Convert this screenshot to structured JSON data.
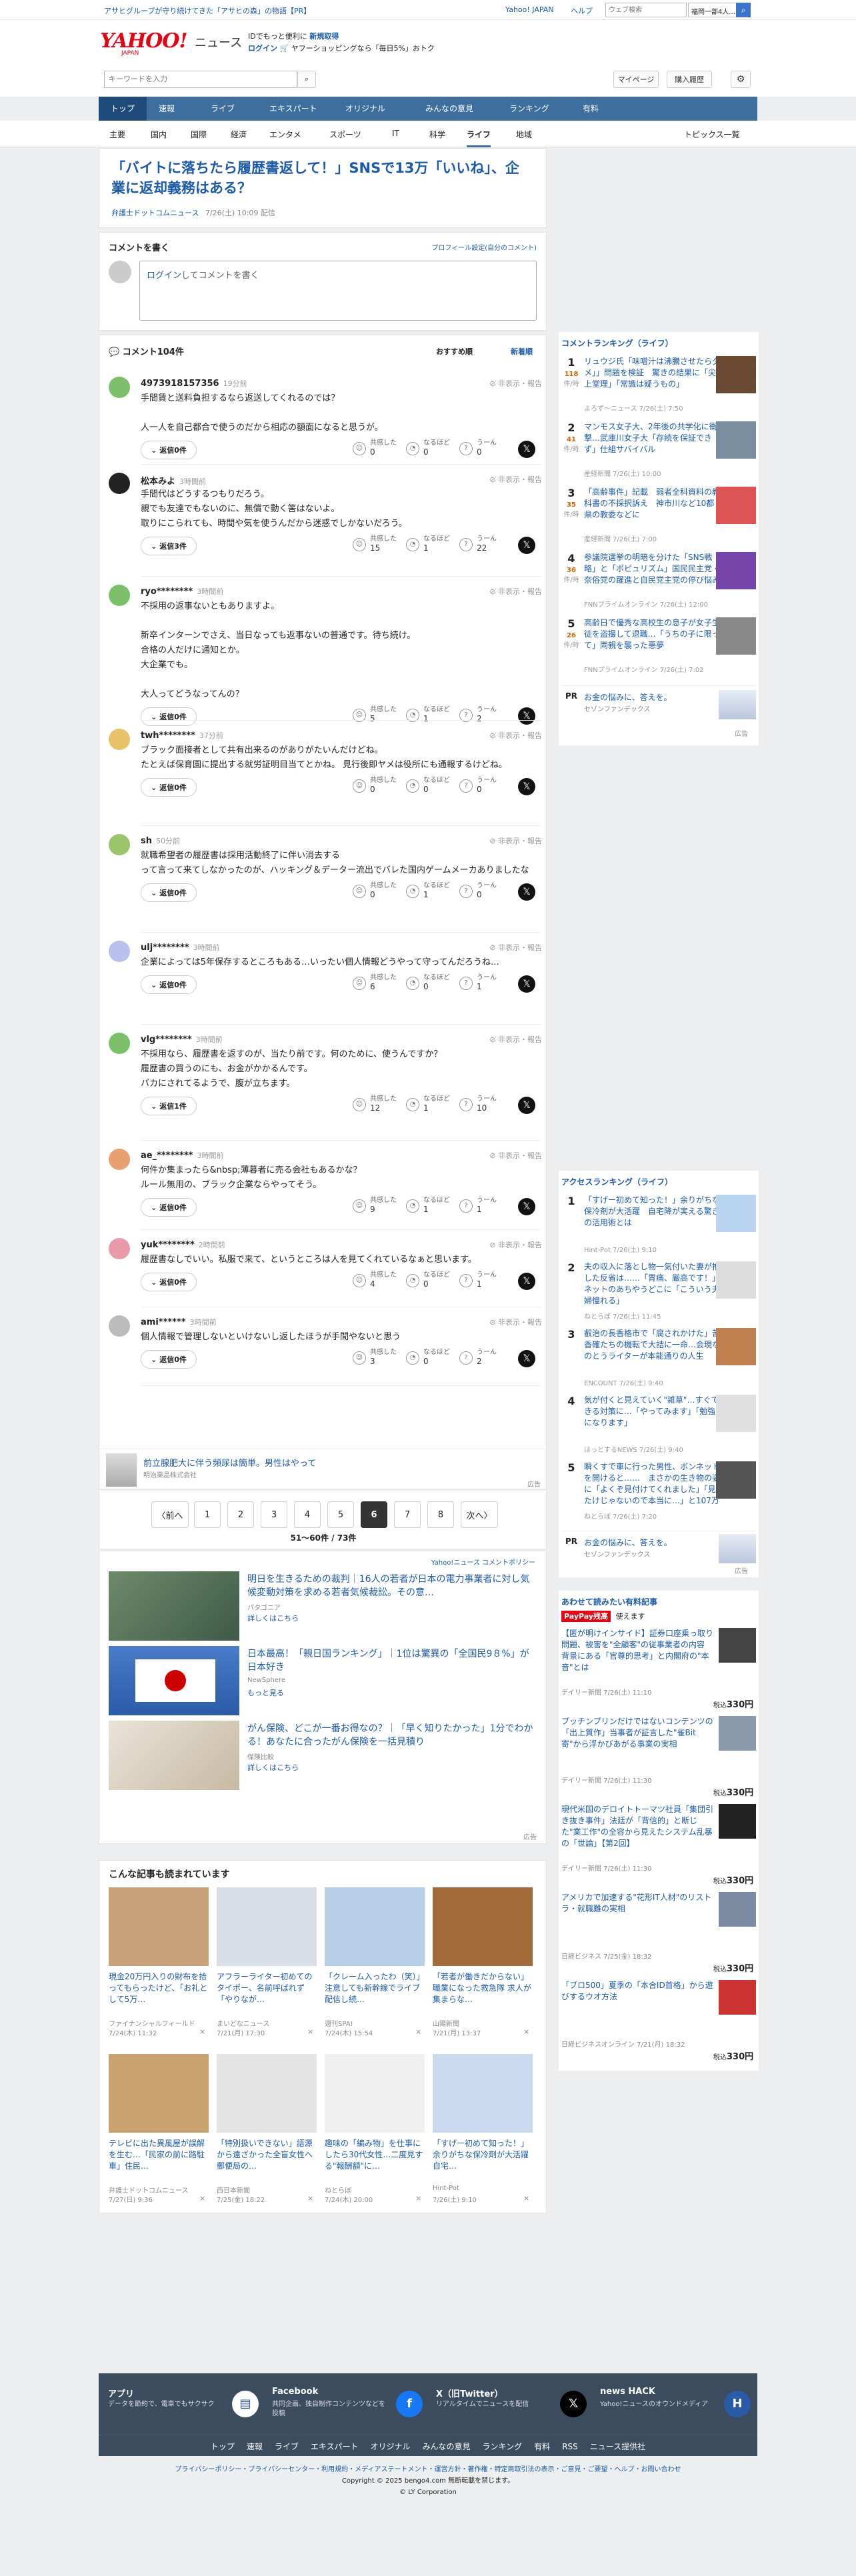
{
  "topbar": {
    "left_text": "アサヒグループが守り続けてきた「アサヒの森」の物語【PR】",
    "links": [
      "Yahoo! JAPAN",
      "ヘルプ"
    ],
    "search_placeholder": "ウェブ検索",
    "weather": "福岡一部4人..."
  },
  "header": {
    "logo": "YAHOO!",
    "logo_sub": "JAPAN",
    "brand": "ニュース",
    "promo1": "IDでもっと便利に",
    "promo1_link": "新規取得",
    "promo2_link": "ログイン",
    "promo2": "ヤフーショッピングなら「毎日5%」おトク",
    "search_placeholder": "キーワードを入力",
    "mypage": "マイページ",
    "purchase": "購入履歴"
  },
  "nav": {
    "items": [
      "トップ",
      "速報",
      "ライブ",
      "エキスパート",
      "オリジナル",
      "みんなの意見",
      "ランキング",
      "有料"
    ],
    "active": 0
  },
  "subnav": {
    "items": [
      "主要",
      "国内",
      "国際",
      "経済",
      "エンタメ",
      "スポーツ",
      "IT",
      "科学",
      "ライフ",
      "地域"
    ],
    "active": 8,
    "right": "トピックス一覧"
  },
  "article": {
    "title": "「バイトに落ちたら履歴書返して！」SNSで13万「いいね」、企業に返却義務はある？",
    "source": "弁護士ドットコムニュース",
    "date": "7/26(土) 10:09 配信"
  },
  "comment_box": {
    "heading": "コメントを書く",
    "profile_link": "プロフィール設定(自分のコメント)",
    "login_link": "ログイン",
    "placeholder_rest": "してコメントを書く"
  },
  "comments_header": {
    "title": "コメント104件",
    "sort_recommended": "おすすめ順",
    "sort_new": "新着順"
  },
  "reaction_labels": {
    "agree": "共感した",
    "understand": "なるほど",
    "hmm": "うーん"
  },
  "action_text": "非表示・報告",
  "comments": [
    {
      "name": "4973918157356",
      "time": "19分前",
      "text": "手間賃と送料負担するなら返送してくれるのでは？\n\n人一人を自己都合で使うのだから相応の額面になると思うが。",
      "reply": "返信0件",
      "agree": "0",
      "understand": "0",
      "hmm": "0",
      "color": "#7cbf6a"
    },
    {
      "name": "松本みよ",
      "time": "3時間前",
      "text": "手間代はどうするつもりだろう。\n親でも友達でもないのに、無償で動く筈はないよ。\n取りにこられても、時間や気を使うんだから迷惑でしかないだろう。",
      "reply": "返信3件",
      "agree": "15",
      "understand": "1",
      "hmm": "22",
      "color": "#222"
    },
    {
      "name": "ryo********",
      "time": "3時間前",
      "text": "不採用の返事ないともありますよ。\n\n新卒インターンでさえ、当日なっても返事ないの普通です。待ち続け。\n合格の人だけに通知とか。\n大企業でも。\n\n大人ってどうなってんの？",
      "reply": "返信0件",
      "agree": "5",
      "understand": "1",
      "hmm": "2",
      "color": "#7cbf6a"
    },
    {
      "name": "twh********",
      "time": "37分前",
      "text": "ブラック面接者として共有出来るのがありがたいんだけどね。\nたとえば保育園に提出する就労証明目当てとかね。 見行後即ヤメは役所にも通報するけどね。",
      "reply": "返信0件",
      "agree": "0",
      "understand": "0",
      "hmm": "0",
      "color": "#e8c26a"
    },
    {
      "name": "sh",
      "time": "50分前",
      "text": "就職希望者の履歴書は採用活動終了に伴い消去する\nって言って来てしなかったのが、ハッキング＆データー流出でバレた国内ゲームメーカありましたな",
      "reply": "返信0件",
      "agree": "0",
      "understand": "1",
      "hmm": "0",
      "color": "#9ac46a"
    },
    {
      "name": "ulj********",
      "time": "3時間前",
      "text": "企業によっては5年保存するところもある…いったい個人情報どうやって守ってんだろうね…",
      "reply": "返信0件",
      "agree": "6",
      "understand": "0",
      "hmm": "1",
      "color": "#b8c0ee"
    },
    {
      "name": "vlg********",
      "time": "3時間前",
      "text": "不採用なら、履歴書を返すのが、当たり前です。何のために、使うんですか？\n履歴書の買うのにも、お金がかかるんです。\nバカにされてるようで、腹が立ちます。",
      "reply": "返信1件",
      "agree": "12",
      "understand": "1",
      "hmm": "10",
      "color": "#7cbf6a"
    },
    {
      "name": "ae_********",
      "time": "3時間前",
      "text": "何件か集まったら&nbsp;薄暮者に売る会社もあるかな？\nルール無用の、ブラック企業ならやってそう。",
      "reply": "返信0件",
      "agree": "9",
      "understand": "1",
      "hmm": "1",
      "color": "#e8a070"
    },
    {
      "name": "yuk********",
      "time": "2時間前",
      "text": "履歴書なしでいい。私服で来て、というところは人を見てくれているなぁと思います。",
      "reply": "返信0件",
      "agree": "4",
      "understand": "0",
      "hmm": "1",
      "color": "#e89aaa"
    },
    {
      "name": "ami******",
      "time": "3時間前",
      "text": "個人情報で管理しないといけないし返したほうが手間やないと思う",
      "reply": "返信0件",
      "agree": "3",
      "understand": "0",
      "hmm": "2",
      "color": "#bbb"
    }
  ],
  "ad_inline": {
    "text": "前立腺肥大に伴う頻尿は簡単。男性はやって",
    "sub": "明治薬品株式会社",
    "label": "広告"
  },
  "pagination": {
    "prev": "〈前へ",
    "pages": [
      "1",
      "2",
      "3",
      "4",
      "5",
      "6",
      "7",
      "8"
    ],
    "active": "6",
    "next": "次へ〉",
    "summary": "51〜60件 / 73件"
  },
  "policy_link": "Yahoo!ニュース コメントポリシー",
  "ads": [
    {
      "title": "明日を生きるための裁判｜16人の若者が日本の電力事業者に対し気候変動対策を求める若者気候裁訟。その意…",
      "source": "パタゴニア",
      "cta": "詳しくはこちら"
    },
    {
      "title": "日本最高！「親日国ランキング」｜1位は驚異の「全国民9８%」が日本好き",
      "source": "NewSphere",
      "cta": "もっと見る"
    },
    {
      "title": "がん保険、どこが一番お得なの？｜「早く知りたかった」1分でわかる！あなたに合ったがん保険を一括見積り",
      "source": "保険比較",
      "cta": "詳しくはこちら"
    }
  ],
  "ad_label": "広告",
  "also_read": {
    "heading": "こんな記事も読まれています",
    "items": [
      {
        "title": "現金20万円入りの財布を拾ってもらったけど、「お礼として5万…",
        "source": "ファイナンシャルフィールド",
        "date": "7/24(木) 11:32"
      },
      {
        "title": "アフラーライター初めてのタイポー、名前呼ばれず「やりなが…",
        "source": "まいどなニュース",
        "date": "7/21(月) 17:30"
      },
      {
        "title": "「クレーム入ったわ（笑）」注意しても新幹線でライブ配信し続…",
        "source": "週刊SPA!",
        "date": "7/24(木) 15:54"
      },
      {
        "title": "「若者が働きだからない」職業になった救急隊 求人が集まらな…",
        "source": "山陽新聞",
        "date": "7/21(月) 13:37"
      },
      {
        "title": "テレビに出た異風屋が誤解を生む…「民家の前に路駐車」住民…",
        "source": "弁護士ドットコムニュース",
        "date": "7/27(日) 9:36"
      },
      {
        "title": "「特別扱いできない」語源から遠ざかった全盲女性へ 郵便局の…",
        "source": "西日本新聞",
        "date": "7/25(金) 18:22"
      },
      {
        "title": "趣味の「編み物」を仕事にしたら30代女性…二度見する\"報酬額\"に…",
        "source": "ねとらぼ",
        "date": "7/24(木) 20:00"
      },
      {
        "title": "「すげー初めて知った！」余りがちな保冷剤が大活躍 自宅…",
        "source": "Hint-Pot",
        "date": "7/26(土) 9:10"
      }
    ]
  },
  "sidebar": {
    "comment_ranking": {
      "heading": "コメントランキング（ライフ）",
      "unit": "件/時",
      "items": [
        {
          "num": "1",
          "count": "118",
          "title": "リュウジ氏「味噌汁は沸騰させたらダメ」」問題を検証　驚きの結果に「尖上堂理」「常識は疑うもの」",
          "src": "よろず〜ニュース 7/26(土) 7:50"
        },
        {
          "num": "2",
          "count": "41",
          "title": "マンモス女子大、2年後の共学化に衝撃…武庫川女子大「存続を保証できず」仕組サバイバル",
          "src": "産経新聞 7/26(土) 10:00"
        },
        {
          "num": "3",
          "count": "35",
          "title": "「高齢事件」記載　弱者全科資料の教科書の不採択訴え　神市川など10都県の教委などに",
          "src": "産経新聞 7/26(土) 7:00"
        },
        {
          "num": "4",
          "count": "36",
          "title": "参議院選挙の明暗を分けた「SNS戦略」と「ポピュリズム」国民民主党・奈俗党の躍進と自民党主党の停び悩み",
          "src": "FNNプライムオンライン 7/26(土) 12:00"
        },
        {
          "num": "5",
          "count": "26",
          "title": "高齢日で優秀な高校生の息子が女子生徒を盗撮して退職…「うちの子に限って」両親を襲った悪夢",
          "src": "FNNプライムオンライン 7/26(土) 7:02"
        }
      ]
    },
    "pr1": {
      "label": "PR",
      "title": "お金の悩みに、答えを。",
      "src": "セゾンファンデックス"
    },
    "access_ranking": {
      "heading": "アクセスランキング（ライフ）",
      "items": [
        {
          "num": "1",
          "title": "「すげー初めて知った！」余りがちな保冷剤が大活躍　自宅降が実える驚きの活用術とは",
          "src": "Hint-Pot 7/26(土) 9:10"
        },
        {
          "num": "2",
          "title": "夫の収入に落とし物一気付いた妻が推した反省は……「胃痛、厳高です！」ネットのあちやうどこに「こういう夫婦憧れる」",
          "src": "ねとらぼ 7/26(土) 11:45"
        },
        {
          "num": "3",
          "title": "叡治の長香格市で「腐されかけた」苦香確たちの機転で大詰に一命…会現なのとうライターが本能通りの人生",
          "src": "ENCOUNT 7/26(土) 9:40"
        },
        {
          "num": "4",
          "title": "気が付くと見えていく\"雑草\"…すぐできる対策に…「やってみます」「勉強になります」",
          "src": "ほっとするNEWS 7/26(土) 9:40"
        },
        {
          "num": "5",
          "title": "瞬くすで車に行った男性、ボンネットを開けると……　まさかの生き物の姿に「よくぞ見付けてくれました」「見たけじゃないので本当に…」と107万表示",
          "src": "ねとらぼ 7/26(土) 7:20"
        }
      ]
    },
    "pr2": {
      "label": "PR",
      "title": "お金の悩みに、答えを。",
      "src": "セゾンファンデックス"
    },
    "paid": {
      "heading": "あわせて読みたい有料記事",
      "badge": "PayPay残高",
      "badge_sub": "使えます",
      "price_label": "税込",
      "price": "330円",
      "items": [
        {
          "title": "【匿が明けインサイド】証券口座乗っ取り問題、被害を\"全顧客\"の従事業者の内容　背景にある「官尊的思考」と内閣府の\"本音\"とは",
          "src": "デイリー新聞 7/26(土) 11:10"
        },
        {
          "title": "プッチンプリンだけではないコンテンツの「出上質作」当事者が証言した\"雀Bit 寄\"から浮かびあがる事業の実相",
          "src": "デイリー新聞 7/26(土) 11:30"
        },
        {
          "title": "現代米国のデロイトトーマツ社員「集団引き抜き事件」法廷が「背信的」と断じた\"業工作\"の全容から見えたシステム乱暴の「世論」【第2回】",
          "src": "デイリー新聞 7/26(土) 11:30"
        },
        {
          "title": "アメリカで加速する\"花形IT人材\"のリストラ・就職難の実相",
          "src": "日経ビジネス 7/25(金) 18:32"
        },
        {
          "title": "「ブロ500」夏季の「本合ID首格」から遊びするウオ方法",
          "src": "日経ビジネスオンライン 7/21(月) 18:32"
        }
      ]
    },
    "ad_label": "広告"
  },
  "footer": {
    "apps": [
      {
        "title": "アプリ",
        "desc": "データを節約で、電車でもサクサク"
      },
      {
        "title": "Facebook",
        "desc": "共同企画、独自制作コンテンツなどを投稿"
      },
      {
        "title": "X（旧Twitter）",
        "desc": "リアルタイムでニュースを配信"
      },
      {
        "title": "news HACK",
        "desc": "Yahoo!ニュースのオウンドメディア"
      }
    ],
    "nav": [
      "トップ",
      "速報",
      "ライブ",
      "エキスパート",
      "オリジナル",
      "みんなの意見",
      "ランキング",
      "有料",
      "RSS",
      "ニュース提供社"
    ],
    "policy_links": "プライバシーポリシー・プライバシーセンター・利用規約・メディアステートメント・運営方針・著作権・特定商取引法の表示・ご意見・ご要望・ヘルプ・お問い合わせ",
    "copyright": "Copyright © 2025 bengo4.com 無断転載を禁じます。",
    "corp": "© LY Corporation"
  }
}
